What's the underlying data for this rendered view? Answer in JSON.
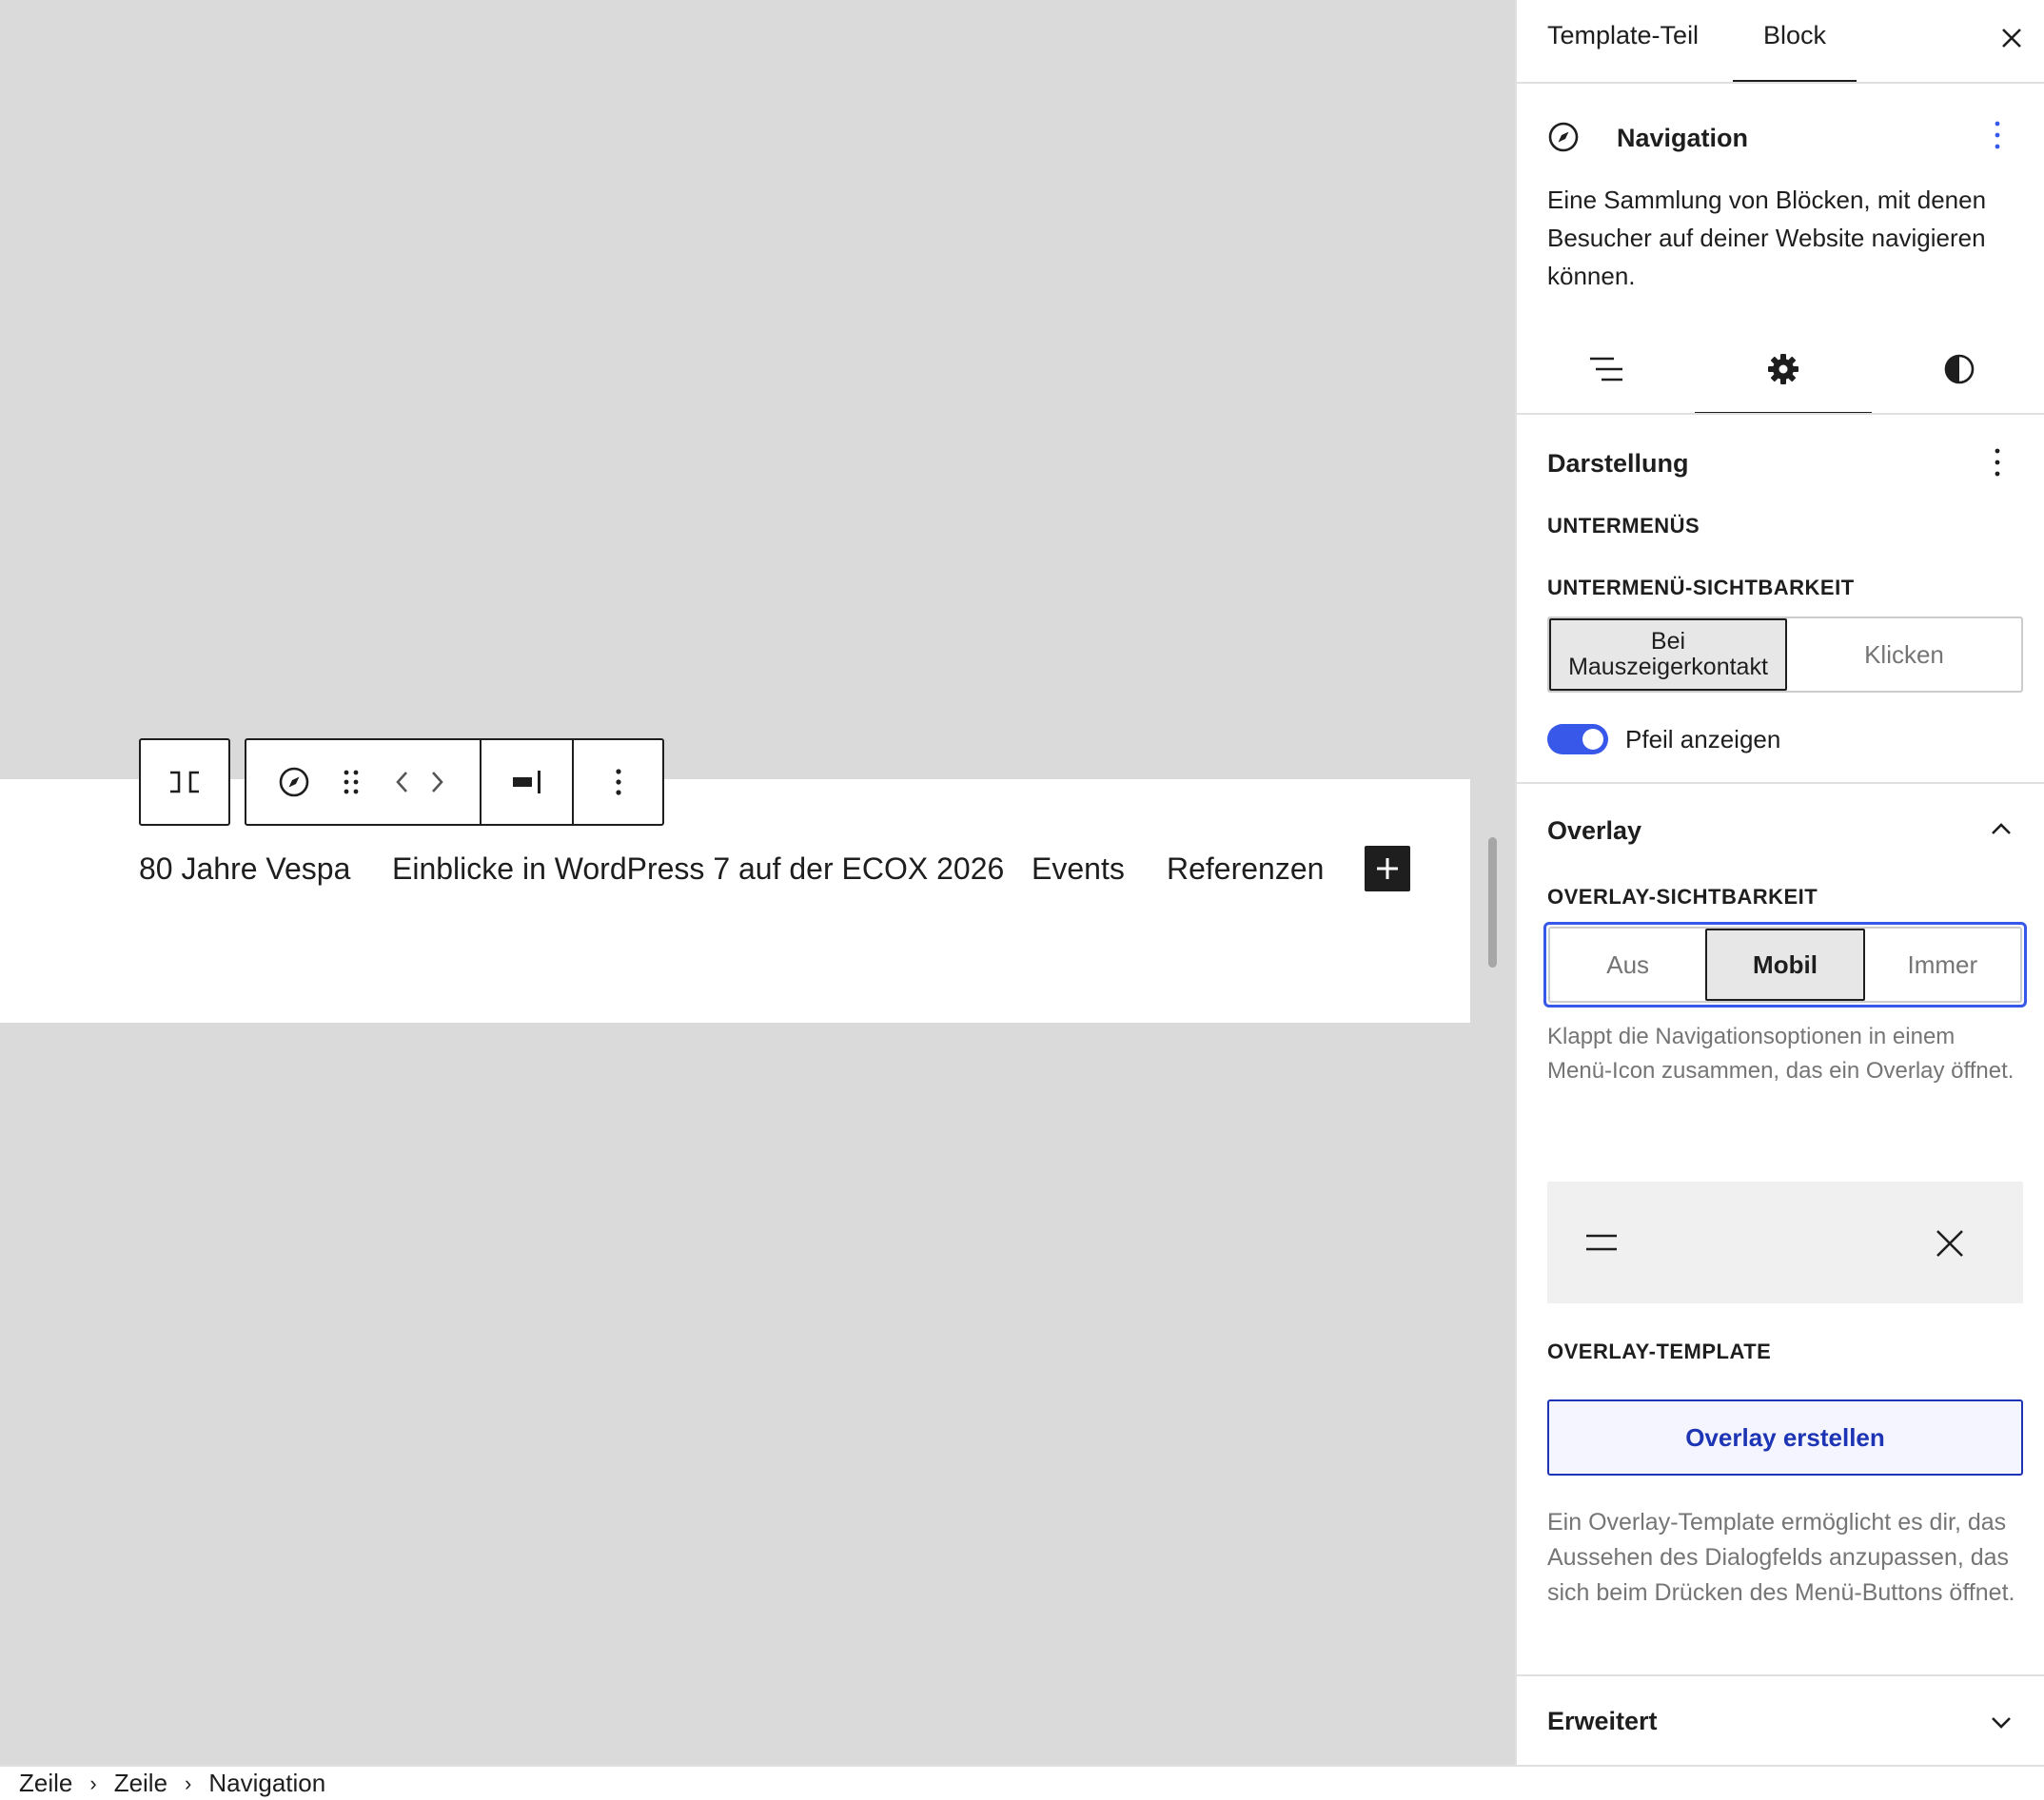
{
  "canvas": {
    "nav_links": [
      "80 Jahre Vespa",
      "Einblicke in WordPress 7 auf der ECOX 2026",
      "Events",
      "Referenzen"
    ],
    "add_block_label": "+"
  },
  "toolbar": {
    "icons": [
      "parent-block-icon",
      "navigation-compass-icon",
      "drag-handle-icon",
      "move-arrows-icon",
      "justify-icon",
      "more-options-icon"
    ]
  },
  "sidebar": {
    "tabs": [
      "Template-Teil",
      "Block"
    ],
    "active_tab": "Block",
    "block_title": "Navigation",
    "block_description": "Eine Sammlung von Blöcken, mit denen Besucher auf deiner Website navigieren können.",
    "inspector_tabs": [
      "list-view",
      "settings",
      "styles"
    ],
    "active_inspector_tab": "settings",
    "darstellung": {
      "title": "Darstellung",
      "submenus_heading": "UNTERMENÜS",
      "visibility_heading": "UNTERMENÜ-SICHTBARKEIT",
      "visibility_options": [
        "Bei Mauszeigerkontakt",
        "Klicken"
      ],
      "visibility_selected": "Bei Mauszeigerkontakt",
      "arrow_toggle_label": "Pfeil anzeigen",
      "arrow_toggle_on": true
    },
    "overlay": {
      "title": "Overlay",
      "visibility_heading": "OVERLAY-SICHTBARKEIT",
      "options": [
        "Aus",
        "Mobil",
        "Immer"
      ],
      "selected": "Mobil",
      "help": "Klappt die Navigationsoptionen in einem Menü-Icon zusammen, das ein Overlay öffnet.",
      "template_heading": "OVERLAY-TEMPLATE",
      "create_button": "Overlay erstellen",
      "template_help": "Ein Overlay-Template ermöglicht es dir, das Aussehen des Dialogfelds anzupassen, das sich beim Drücken des Menü-Buttons öffnet."
    },
    "advanced_title": "Erweitert"
  },
  "breadcrumb": [
    "Zeile",
    "Zeile",
    "Navigation"
  ],
  "colors": {
    "accent": "#3858e9",
    "link_blue": "#1d35b4",
    "canvas_bg": "#dadada",
    "panel_gray": "#f0f0f0"
  }
}
